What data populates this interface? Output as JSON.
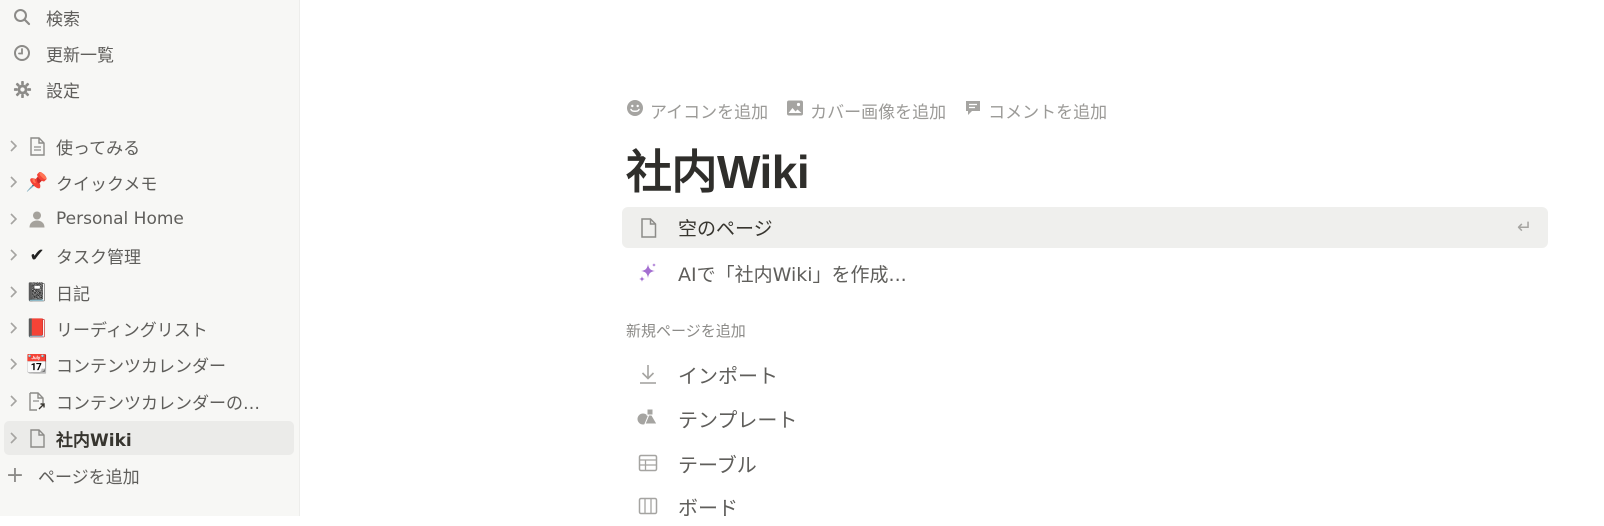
{
  "sidebar": {
    "nav": [
      {
        "label": "検索",
        "icon": "search-icon"
      },
      {
        "label": "更新一覧",
        "icon": "clock-icon"
      },
      {
        "label": "設定",
        "icon": "gear-icon"
      }
    ],
    "pages": [
      {
        "label": "使ってみる",
        "icon": "document-icon"
      },
      {
        "label": "クイックメモ",
        "icon": "pushpin-icon",
        "emoji": "📌"
      },
      {
        "label": "Personal Home",
        "icon": "person-icon"
      },
      {
        "label": "タスク管理",
        "icon": "checkmark-icon",
        "emoji": "✔"
      },
      {
        "label": "日記",
        "icon": "notebook-icon",
        "emoji": "📓"
      },
      {
        "label": "リーディングリスト",
        "icon": "book-icon",
        "emoji": "📕"
      },
      {
        "label": "コンテンツカレンダー",
        "icon": "calendar-icon",
        "emoji": "📆"
      },
      {
        "label": "コンテンツカレンダーの…",
        "icon": "linked-document-icon"
      },
      {
        "label": "社内Wiki",
        "icon": "document-icon",
        "active": true
      }
    ],
    "add_page_label": "ページを追加"
  },
  "main": {
    "actions": [
      {
        "label": "アイコンを追加",
        "icon": "smiley-icon"
      },
      {
        "label": "カバー画像を追加",
        "icon": "image-icon"
      },
      {
        "label": "コメントを追加",
        "icon": "comment-icon"
      }
    ],
    "title": "社内Wiki",
    "empty_page_label": "空のページ",
    "enter_hint": "↵",
    "ai_label": "AIで「社内Wiki」を作成...",
    "new_page_section": "新規ページを追加",
    "new_items": [
      {
        "label": "インポート",
        "icon": "download-icon"
      },
      {
        "label": "テンプレート",
        "icon": "shapes-icon"
      },
      {
        "label": "テーブル",
        "icon": "table-icon"
      },
      {
        "label": "ボード",
        "icon": "board-icon"
      }
    ]
  },
  "colors": {
    "sidebar_bg": "#f7f7f5",
    "active_bg": "#ebebe9",
    "hover_bg": "#efefed",
    "text": "#37352f",
    "muted": "#9b9a97",
    "ai_accent": "#a46fd1"
  }
}
